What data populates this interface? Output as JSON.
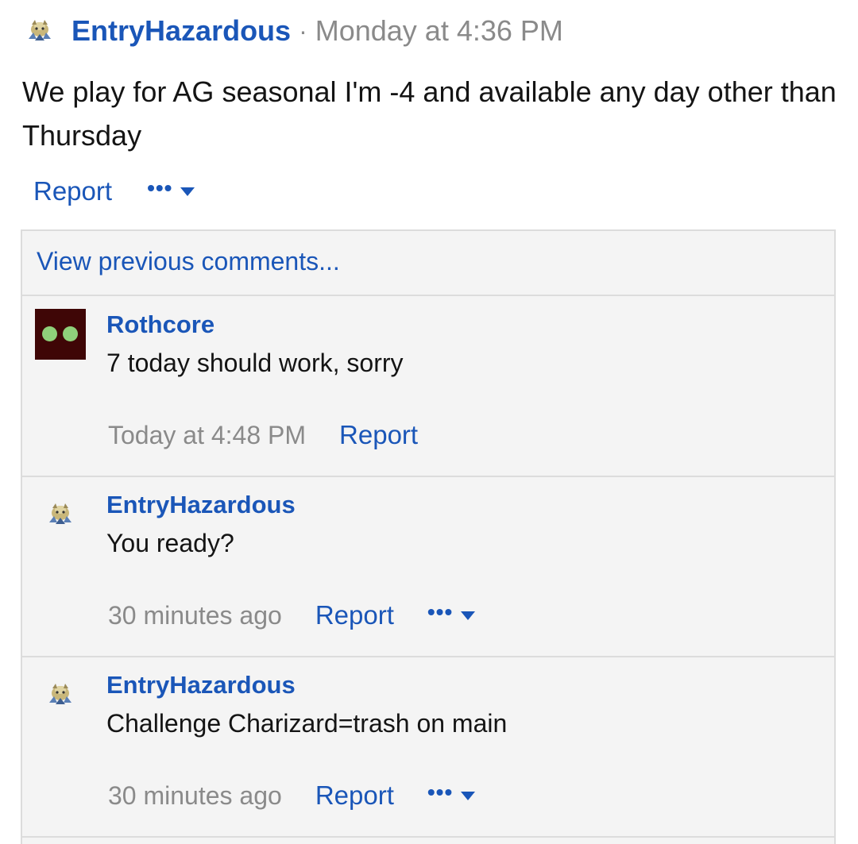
{
  "post": {
    "author": "EntryHazardous",
    "separator": "·",
    "time": "Monday at 4:36 PM",
    "body": "We play for AG seasonal I'm -4 and available any day other than Thursday",
    "report_label": "Report",
    "more_dots": "•••",
    "avatar_icon": "pokemon-sprite-icon"
  },
  "comments_section": {
    "view_previous": "View previous comments...",
    "items": [
      {
        "author": "Rothcore",
        "text": "7 today should work, sorry",
        "time": "Today at 4:48 PM",
        "report_label": "Report",
        "has_more_menu": false,
        "avatar_icon": "two-green-dots-avatar"
      },
      {
        "author": "EntryHazardous",
        "text": "You ready?",
        "time": "30 minutes ago",
        "report_label": "Report",
        "has_more_menu": true,
        "more_dots": "•••",
        "avatar_icon": "pokemon-sprite-icon"
      },
      {
        "author": "EntryHazardous",
        "text": "Challenge Charizard=trash on main",
        "time": "30 minutes ago",
        "report_label": "Report",
        "has_more_menu": true,
        "more_dots": "•••",
        "avatar_icon": "pokemon-sprite-icon"
      }
    ]
  },
  "colors": {
    "link": "#1a56b8",
    "muted": "#8a8a8a",
    "panel_bg": "#f4f4f4",
    "border": "#dcdcdc"
  }
}
